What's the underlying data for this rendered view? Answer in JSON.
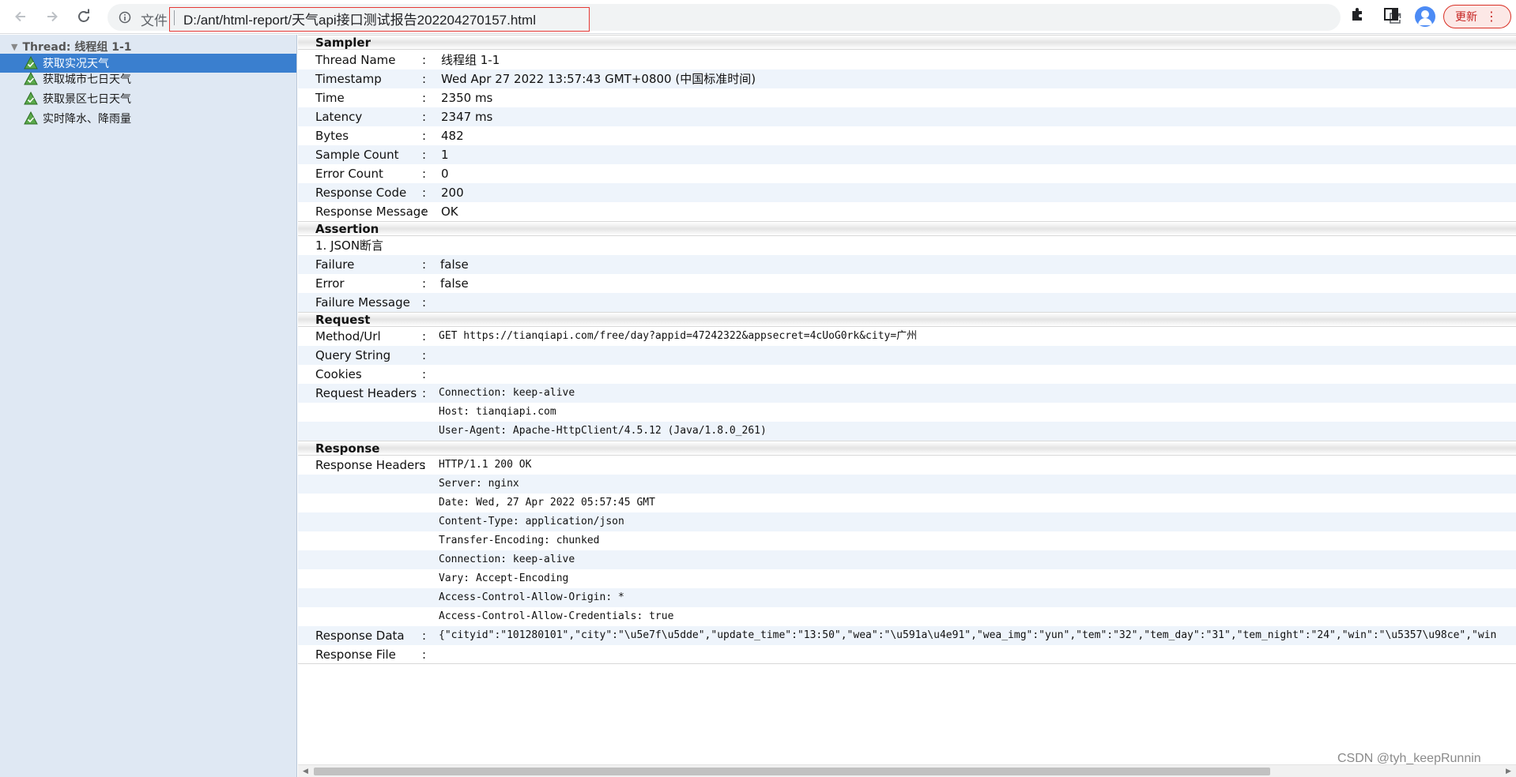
{
  "browser": {
    "scheme_label": "文件",
    "url": "D:/ant/html-report/天气api接口测试报告202204270157.html",
    "update_label": "更新"
  },
  "sidebar": {
    "thread_label": "Thread: 线程组 1-1",
    "samples": [
      {
        "label": "获取实况天气",
        "selected": true
      },
      {
        "label": "获取城市七日天气",
        "selected": false
      },
      {
        "label": "获取景区七日天气",
        "selected": false
      },
      {
        "label": "实时降水、降雨量",
        "selected": false
      }
    ]
  },
  "sampler": {
    "title": "Sampler",
    "rows": [
      {
        "key": "Thread Name",
        "value": "线程组 1-1"
      },
      {
        "key": "Timestamp",
        "value": "Wed Apr 27 2022 13:57:43 GMT+0800 (中国标准时间)"
      },
      {
        "key": "Time",
        "value": "2350 ms"
      },
      {
        "key": "Latency",
        "value": "2347 ms"
      },
      {
        "key": "Bytes",
        "value": "482"
      },
      {
        "key": "Sample Count",
        "value": "1"
      },
      {
        "key": "Error Count",
        "value": "0"
      },
      {
        "key": "Response Code",
        "value": "200"
      },
      {
        "key": "Response Message",
        "value": "OK"
      }
    ]
  },
  "assertion": {
    "title": "Assertion",
    "name": "1. JSON断言",
    "rows": [
      {
        "key": "Failure",
        "value": "false"
      },
      {
        "key": "Error",
        "value": "false"
      },
      {
        "key": "Failure Message",
        "value": ""
      }
    ]
  },
  "request": {
    "title": "Request",
    "method_url_key": "Method/Url",
    "method_url": "GET https://tianqiapi.com/free/day?appid=47242322&appsecret=4cUoG0rk&city=广州",
    "query_string_key": "Query String",
    "query_string": "",
    "cookies_key": "Cookies",
    "cookies": "",
    "headers_key": "Request Headers",
    "headers": [
      "Connection: keep-alive",
      "Host: tianqiapi.com",
      "User-Agent: Apache-HttpClient/4.5.12 (Java/1.8.0_261)"
    ]
  },
  "response": {
    "title": "Response",
    "headers_key": "Response Headers",
    "headers": [
      "HTTP/1.1 200 OK",
      "Server: nginx",
      "Date: Wed, 27 Apr 2022 05:57:45 GMT",
      "Content-Type: application/json",
      "Transfer-Encoding: chunked",
      "Connection: keep-alive",
      "Vary: Accept-Encoding",
      "Access-Control-Allow-Origin: *",
      "Access-Control-Allow-Credentials: true"
    ],
    "data_key": "Response Data",
    "data": "{\"cityid\":\"101280101\",\"city\":\"\\u5e7f\\u5dde\",\"update_time\":\"13:50\",\"wea\":\"\\u591a\\u4e91\",\"wea_img\":\"yun\",\"tem\":\"32\",\"tem_day\":\"31\",\"tem_night\":\"24\",\"win\":\"\\u5357\\u98ce\",\"win",
    "file_key": "Response File",
    "file": ""
  },
  "watermark": "CSDN @tyh_keepRunnin",
  "icons": {
    "back": "arrow-left-icon",
    "forward": "arrow-right-icon",
    "reload": "reload-icon",
    "info": "info-icon",
    "share": "share-icon",
    "star": "star-icon",
    "extensions": "puzzle-icon",
    "side_panel": "side-panel-icon",
    "sample": "success-triangle-icon"
  },
  "colors": {
    "selected": "#3a7fcf",
    "sidebar_bg": "#dfe8f3",
    "alt_row": "#eef4fb",
    "update": "#d93025"
  }
}
